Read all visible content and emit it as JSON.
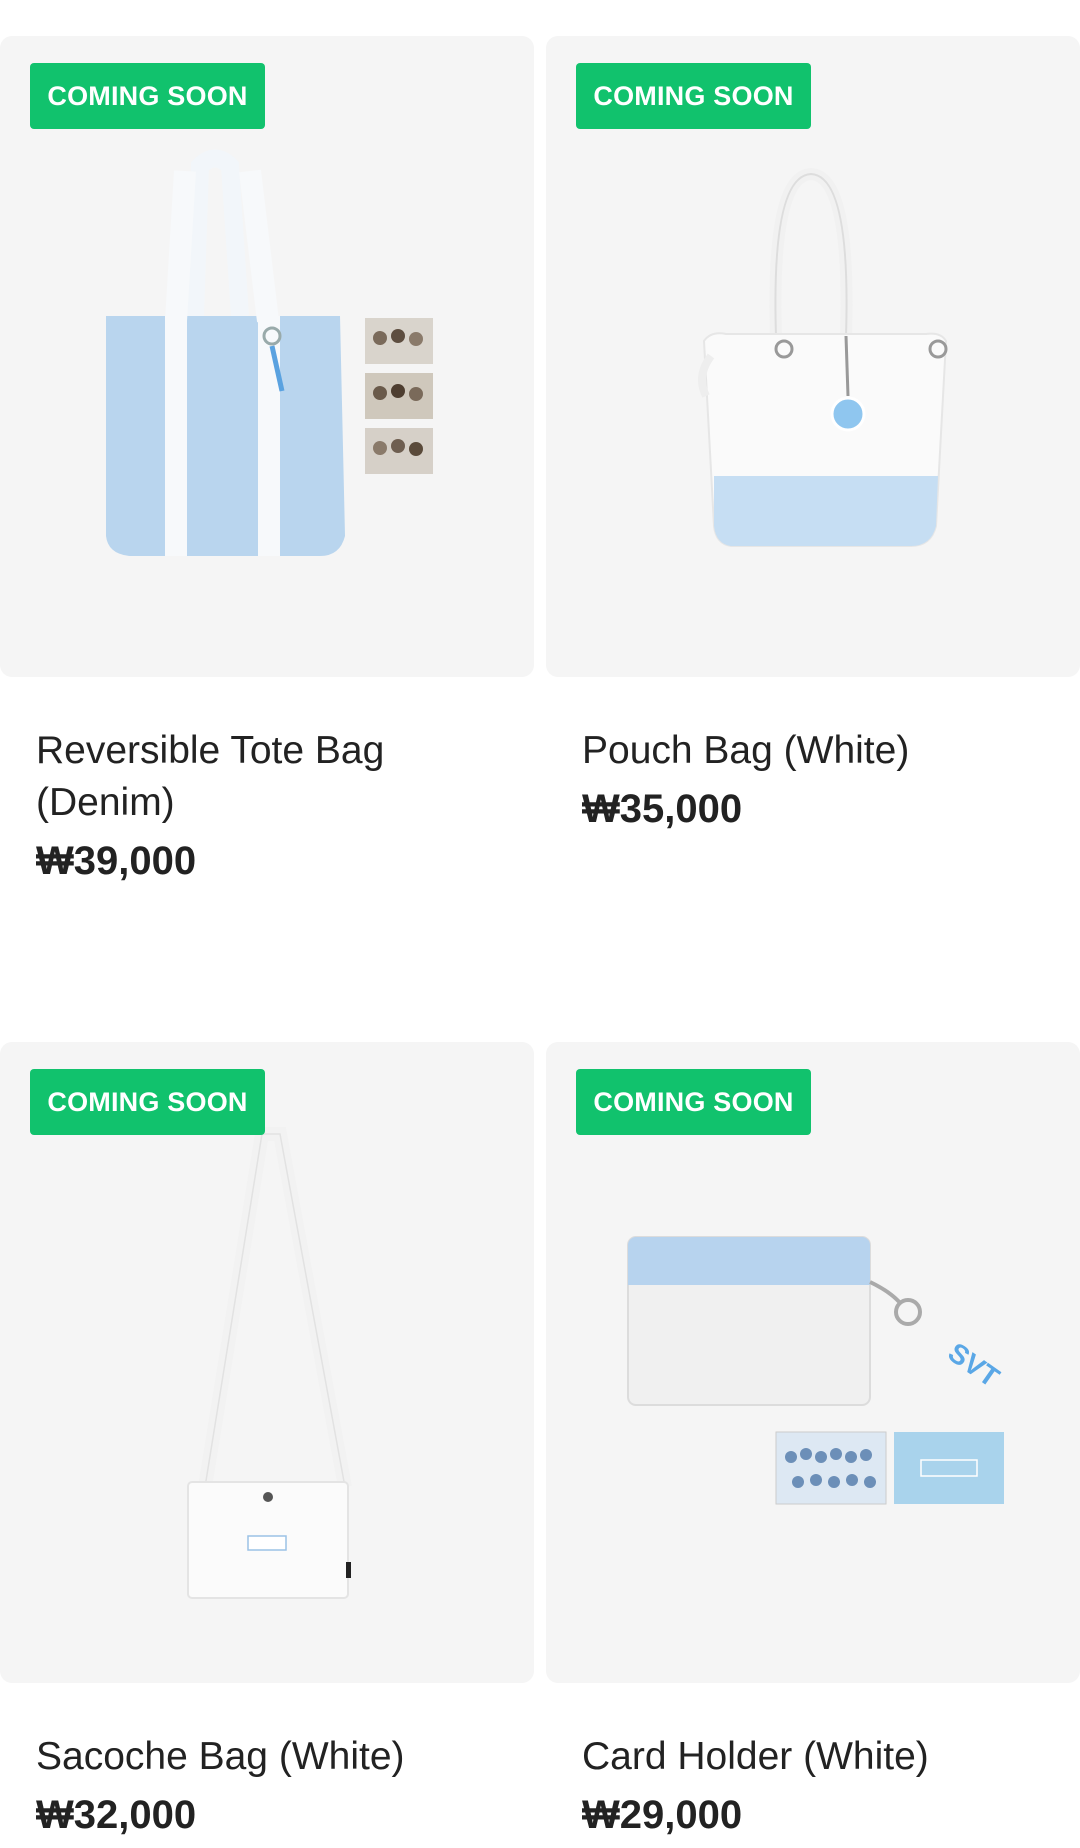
{
  "products": [
    {
      "badge": "COMING SOON",
      "name": "Reversible Tote Bag (Denim)",
      "price": "₩39,000",
      "image_icon": "tote-bag-icon"
    },
    {
      "badge": "COMING SOON",
      "name": "Pouch Bag (White)",
      "price": "₩35,000",
      "image_icon": "pouch-bag-icon"
    },
    {
      "badge": "COMING SOON",
      "name": "Sacoche Bag (White)",
      "price": "₩32,000",
      "image_icon": "sacoche-bag-icon"
    },
    {
      "badge": "COMING SOON",
      "name": "Card Holder (White)",
      "price": "₩29,000",
      "image_icon": "card-holder-icon"
    }
  ],
  "colors": {
    "badge_bg": "#11c26d",
    "card_bg": "#f5f5f5",
    "text": "#222222"
  }
}
